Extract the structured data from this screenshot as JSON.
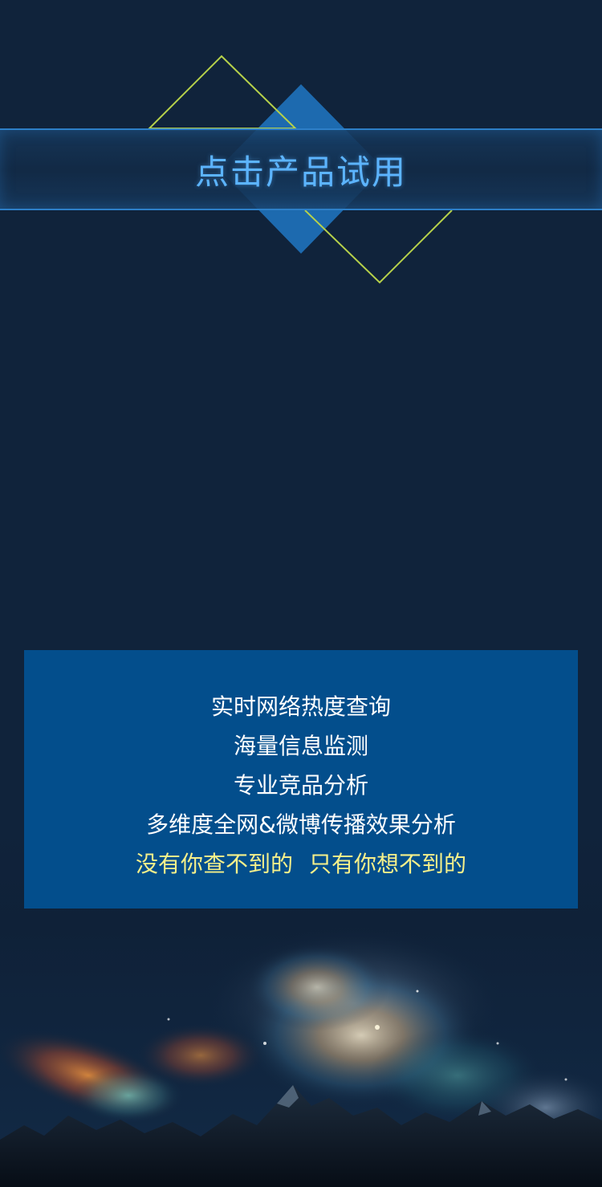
{
  "cta": {
    "label": "点击产品试用"
  },
  "info": {
    "lines": [
      "实时网络热度查询",
      "海量信息监测",
      "专业竞品分析",
      "多维度全网&微博传播效果分析"
    ],
    "slogan_part1": "没有你查不到的",
    "slogan_part2": "只有你想不到的"
  },
  "colors": {
    "background": "#10233b",
    "cta_text": "#5cb4ff",
    "cta_border": "#2d7fc8",
    "panel": "#034e8c",
    "slogan": "#f6f08a",
    "outline_diamond": "#b6d14a",
    "filled_diamond": "#1f6fb5"
  }
}
